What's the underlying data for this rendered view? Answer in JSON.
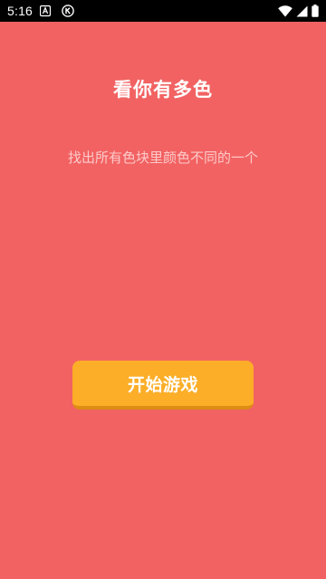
{
  "status_bar": {
    "time": "5:16",
    "notification_icons": [
      "text-a-icon",
      "k-circle-icon"
    ],
    "system_icons": [
      "wifi-icon",
      "cell-signal-icon",
      "battery-icon"
    ]
  },
  "screen": {
    "title": "看你有多色",
    "subtitle": "找出所有色块里颜色不同的一个",
    "start_button_label": "开始游戏"
  },
  "colors": {
    "background": "#f26262",
    "button": "#fcae28",
    "button_shadow": "#dd8c14",
    "status_bar": "#000000"
  }
}
